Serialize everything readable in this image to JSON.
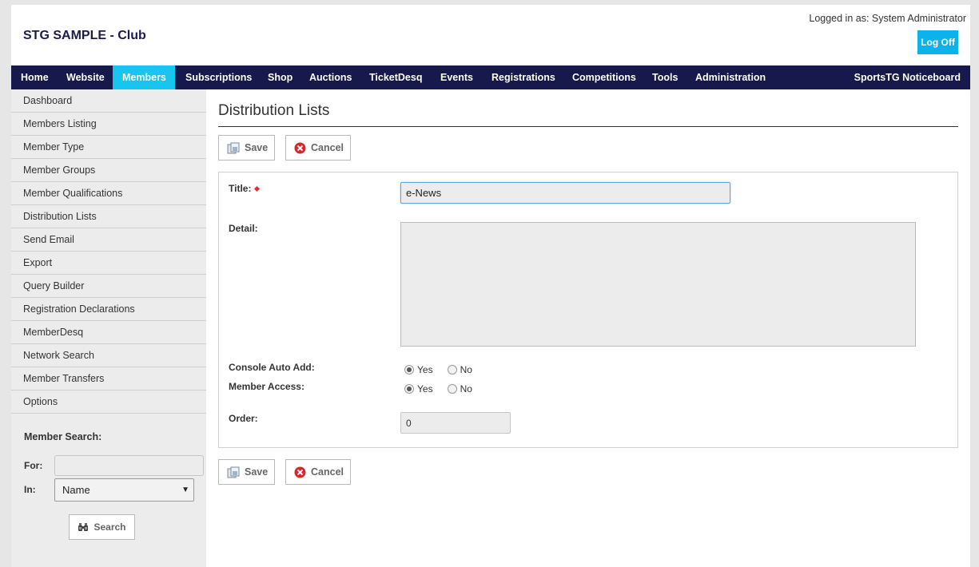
{
  "header": {
    "club_name": "STG SAMPLE - Club",
    "login_text": "Logged in as: System Administrator",
    "logoff_label": "Log Off"
  },
  "nav": {
    "items": [
      "Home",
      "Website",
      "Members",
      "Subscriptions",
      "Shop",
      "Auctions",
      "TicketDesq",
      "Events",
      "Registrations",
      "Competitions",
      "Tools",
      "Administration"
    ],
    "active": "Members",
    "right_item": "SportsTG Noticeboard",
    "bar_color": "#17184b",
    "active_color": "#17c5ef"
  },
  "sidebar": {
    "items": [
      "Dashboard",
      "Members Listing",
      "Member Type",
      "Member Groups",
      "Member Qualifications",
      "Distribution Lists",
      "Send Email",
      "Export",
      "Query Builder",
      "Registration Declarations",
      "MemberDesq",
      "Network Search",
      "Member Transfers",
      "Options"
    ],
    "search": {
      "title": "Member Search:",
      "for_label": "For:",
      "for_value": "",
      "in_label": "In:",
      "in_value": "Name",
      "button_label": "Search",
      "button_icon": "binoculars-icon"
    }
  },
  "main": {
    "page_title": "Distribution Lists",
    "save_label": "Save",
    "save_icon": "save-icon",
    "cancel_label": "Cancel",
    "cancel_icon": "cancel-icon",
    "form": {
      "title_label": "Title:",
      "title_value": "e-News",
      "detail_label": "Detail:",
      "detail_value": "",
      "console_auto_add_label": "Console Auto Add:",
      "console_auto_add_value": "Yes",
      "member_access_label": "Member Access:",
      "member_access_value": "Yes",
      "yes_label": "Yes",
      "no_label": "No",
      "order_label": "Order:",
      "order_value": "0"
    }
  }
}
